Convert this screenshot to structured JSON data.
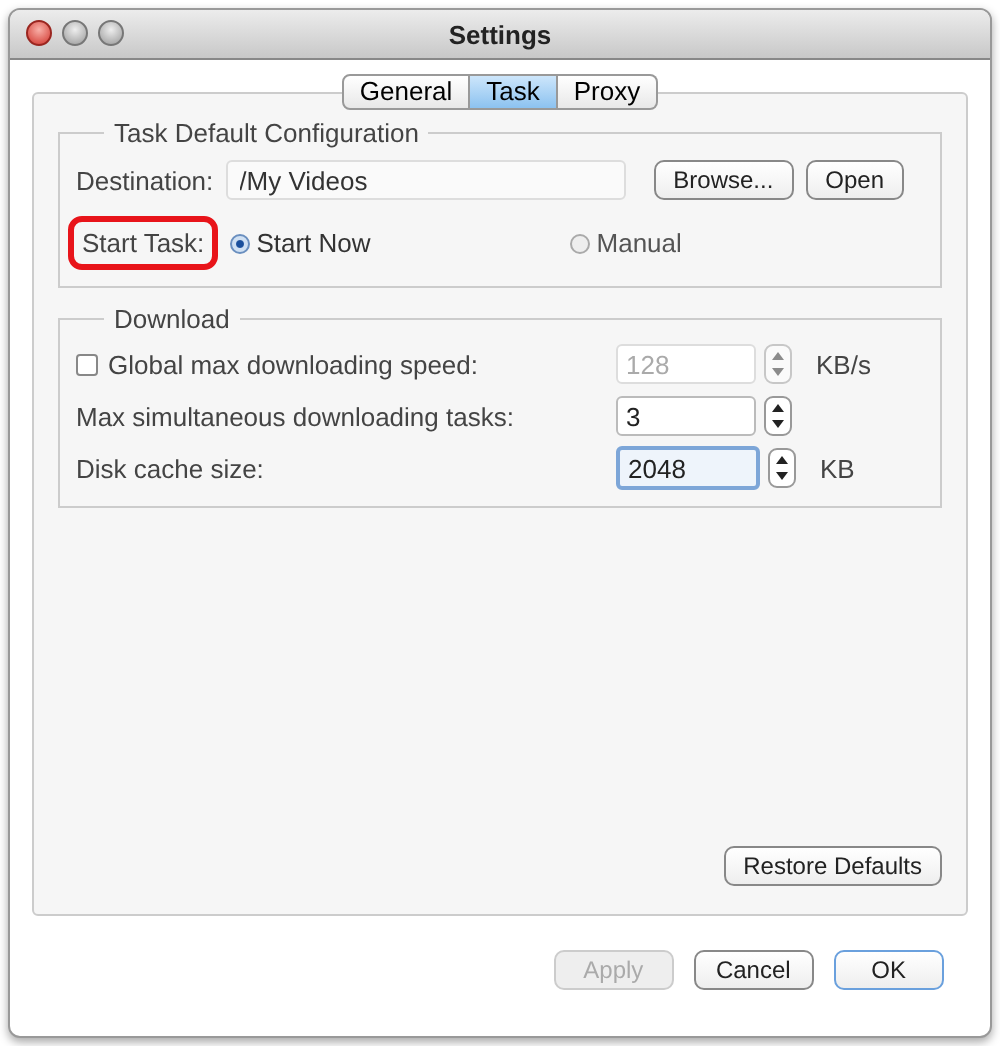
{
  "window": {
    "title": "Settings"
  },
  "tabs": [
    {
      "label": "General",
      "selected": false
    },
    {
      "label": "Task",
      "selected": true
    },
    {
      "label": "Proxy",
      "selected": false
    }
  ],
  "task_group": {
    "title": "Task Default Configuration",
    "destination_label": "Destination:",
    "destination_value": "/My Videos",
    "browse_button": "Browse...",
    "open_button": "Open",
    "start_label": "Start Task:",
    "start_label_highlighted": true,
    "options": [
      {
        "label": "Start Now",
        "selected": true
      },
      {
        "label": "Manual",
        "selected": false
      }
    ]
  },
  "download_group": {
    "title": "Download",
    "rows": [
      {
        "kind": "checkbox",
        "label": "Global max downloading speed:",
        "checked": false,
        "value": "128",
        "disabled": true,
        "focused": false,
        "unit": "KB/s"
      },
      {
        "kind": "plain",
        "label": "Max simultaneous downloading tasks:",
        "value": "3",
        "disabled": false,
        "focused": false
      },
      {
        "kind": "plain",
        "label": "Disk cache size:",
        "value": "2048",
        "disabled": false,
        "focused": true,
        "unit": "KB"
      }
    ]
  },
  "restore_button": "Restore Defaults",
  "buttons": [
    {
      "label": "Apply",
      "disabled": true,
      "default": false
    },
    {
      "label": "Cancel",
      "disabled": false,
      "default": false
    },
    {
      "label": "OK",
      "disabled": false,
      "default": true
    }
  ]
}
